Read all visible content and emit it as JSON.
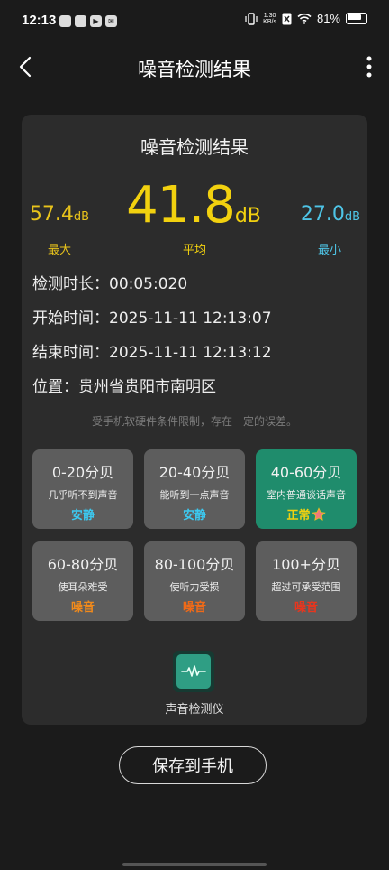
{
  "status_bar": {
    "time": "12:13",
    "net_speed_value": "1.30",
    "net_speed_unit": "KB/s",
    "battery": "81%"
  },
  "header": {
    "title": "噪音检测结果"
  },
  "card": {
    "title": "噪音检测结果",
    "max_value": "57.4",
    "max_unit": "dB",
    "max_label": "最大",
    "avg_value": "41.8",
    "avg_unit": "dB",
    "avg_label": "平均",
    "min_value": "27.0",
    "min_unit": "dB",
    "min_label": "最小",
    "duration": "检测时长：00:05:020",
    "start_time": "开始时间：2025-11-11 12:13:07",
    "end_time": "结束时间：2025-11-11 12:13:12",
    "location": "位置：贵州省贵阳市南明区",
    "disclaimer": "受手机软硬件条件限制，存在一定的误差。"
  },
  "levels": [
    {
      "range": "0-20分贝",
      "desc": "几乎听不到声音",
      "status": "安静"
    },
    {
      "range": "20-40分贝",
      "desc": "能听到一点声音",
      "status": "安静"
    },
    {
      "range": "40-60分贝",
      "desc": "室内普通谈话声音",
      "status": "正常"
    },
    {
      "range": "60-80分贝",
      "desc": "使耳朵难受",
      "status": "噪音"
    },
    {
      "range": "80-100分贝",
      "desc": "使听力受损",
      "status": "噪音"
    },
    {
      "range": "100+分贝",
      "desc": "超过可承受范围",
      "status": "噪音"
    }
  ],
  "app": {
    "name": "声音检测仪",
    "icon": "waveform-icon"
  },
  "save_button": "保存到手机",
  "colors": {
    "accent_yellow": "#f2d10f",
    "accent_blue": "#4ec4e6",
    "active_level": "#1f8c6c",
    "card_bg": "#2c2c2c"
  }
}
